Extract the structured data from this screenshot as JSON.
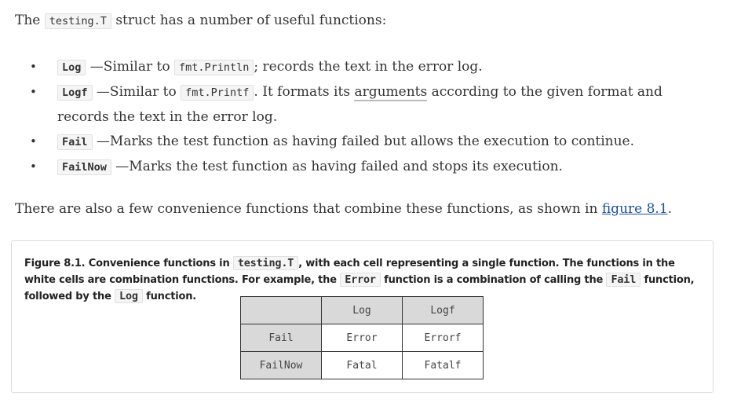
{
  "intro": {
    "prefix": "The ",
    "code": "testing.T",
    "suffix": " struct has a number of useful functions:"
  },
  "functions": [
    {
      "name": "Log",
      "text1": " —Similar to ",
      "code": "fmt.Println",
      "text2": "; records the text in the error log."
    },
    {
      "name": "Logf",
      "text1": " —Similar to ",
      "code": "fmt.Printf",
      "text2": ". It formats its ",
      "underlined": "arguments",
      "text3": " according to the given format and records the text in the error log."
    },
    {
      "name": "Fail",
      "text1": " —Marks the test function as having failed but allows the execution to continue."
    },
    {
      "name": "FailNow",
      "text1": " —Marks the test function as having failed and stops its execution."
    }
  ],
  "also": {
    "text": "There are also a few convenience functions that combine these functions, as shown in ",
    "link": "figure 8.1",
    "end": "."
  },
  "figure": {
    "cap1": "Figure 8.1. Convenience functions in ",
    "code1": "testing.T",
    "cap2": ", with each cell representing a single function. The functions in the white cells are combination functions. For example, the ",
    "code2": "Error",
    "cap3": " function is a combination of calling the ",
    "code3": "Fail",
    "cap4": " function, followed by the ",
    "code4": "Log",
    "cap5": " function.",
    "table": {
      "header": [
        "",
        "Log",
        "Logf"
      ],
      "rows": [
        [
          "Fail",
          "Error",
          "Errorf"
        ],
        [
          "FailNow",
          "Fatal",
          "Fatalf"
        ]
      ]
    }
  }
}
